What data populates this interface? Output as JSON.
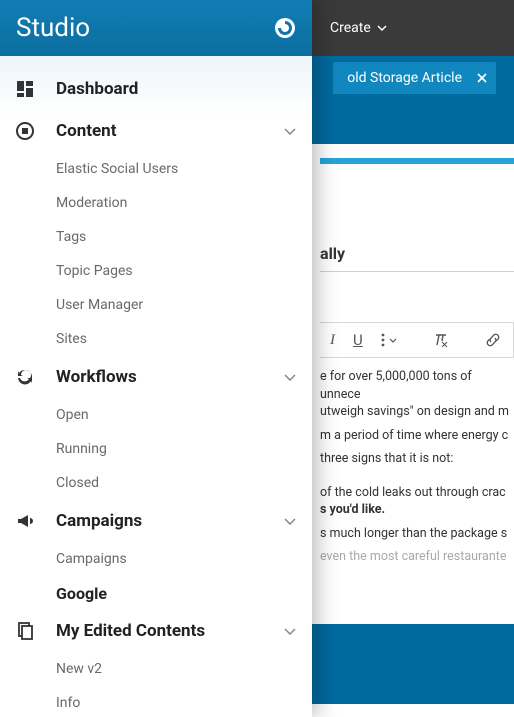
{
  "topbar": {
    "create_label": "Create"
  },
  "tab": {
    "title": "old Storage Article"
  },
  "doc": {
    "heading_suffix": "ally",
    "para1a": "e for over 5,000,000 tons of unnece",
    "para1b": "utweigh savings\" on design and m",
    "para2": "m a period of time where energy c",
    "para3": "three signs that it is not:",
    "bullet1a": "of the cold leaks out through crac",
    "bullet1b": "s you'd like.",
    "bullet2": "s much longer than the package s",
    "bullet3": "even the most careful restaurante"
  },
  "sidebar": {
    "brand": "Studio",
    "sections": [
      {
        "label": "Dashboard"
      },
      {
        "label": "Content",
        "items": [
          "Elastic Social Users",
          "Moderation",
          "Tags",
          "Topic Pages",
          "User Manager",
          "Sites"
        ]
      },
      {
        "label": "Workflows",
        "items": [
          "Open",
          "Running",
          "Closed"
        ]
      },
      {
        "label": "Campaigns",
        "items": [
          "Campaigns",
          "Google"
        ]
      },
      {
        "label": "My Edited Contents",
        "items": [
          "New v2",
          "Info"
        ]
      }
    ]
  }
}
